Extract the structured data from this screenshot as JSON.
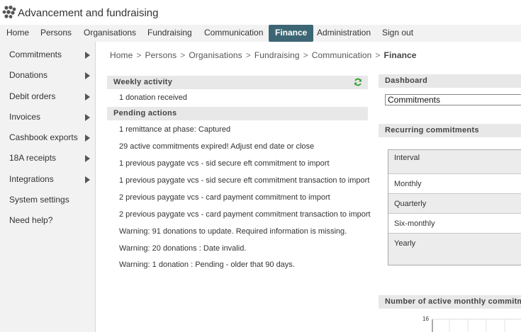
{
  "app": {
    "title": "Advancement and fundraising",
    "logo_icon": "paw-logo-icon"
  },
  "topnav": {
    "items": [
      {
        "label": "Home"
      },
      {
        "label": "Persons"
      },
      {
        "label": "Organisations"
      },
      {
        "label": "Fundraising"
      },
      {
        "label": "Communication"
      },
      {
        "label": "Finance",
        "active": true
      },
      {
        "label": "Administration"
      },
      {
        "label": "Sign out"
      }
    ],
    "active_color": "#3d6674"
  },
  "sidebar": {
    "items": [
      {
        "label": "Commitments",
        "has_submenu": true
      },
      {
        "label": "Donations",
        "has_submenu": true
      },
      {
        "label": "Debit orders",
        "has_submenu": true
      },
      {
        "label": "Invoices",
        "has_submenu": true
      },
      {
        "label": "Cashbook exports",
        "has_submenu": true
      },
      {
        "label": "18A receipts",
        "has_submenu": true
      },
      {
        "label": "Integrations",
        "has_submenu": true
      },
      {
        "label": "System settings",
        "has_submenu": false
      },
      {
        "label": "Need help?",
        "has_submenu": false
      }
    ]
  },
  "breadcrumb": {
    "items": [
      "Home",
      "Persons",
      "Organisations",
      "Fundraising",
      "Communication"
    ],
    "separator": ">",
    "current": "Finance"
  },
  "weekly_activity": {
    "title": "Weekly activity",
    "items": [
      "1 donation received"
    ],
    "refresh_icon": "refresh-icon",
    "refresh_color": "#2e9e2e"
  },
  "pending_actions": {
    "title": "Pending actions",
    "items": [
      "1 remittance at phase: Captured",
      "29 active commitments expired! Adjust end date or close",
      "1 previous paygate vcs - sid secure eft commitment to import",
      "1 previous paygate vcs - sid secure eft commitment transaction to import",
      "2 previous paygate vcs - card payment commitment to import",
      "2 previous paygate vcs - card payment commitment transaction to import",
      "Warning: 91 donations to update. Required information is missing.",
      "Warning: 20 donations : Date invalid.",
      "Warning: 1 donation : Pending - older that 90 days."
    ]
  },
  "dashboard": {
    "title": "Dashboard",
    "selected": "Commitments"
  },
  "recurring_commitments": {
    "title": "Recurring commitments",
    "header": "Interval",
    "rows": [
      "Monthly",
      "Quarterly",
      "Six-monthly",
      "Yearly"
    ]
  },
  "monthly_chart": {
    "title": "Number of active monthly commitme",
    "y_tick_top": "16"
  }
}
